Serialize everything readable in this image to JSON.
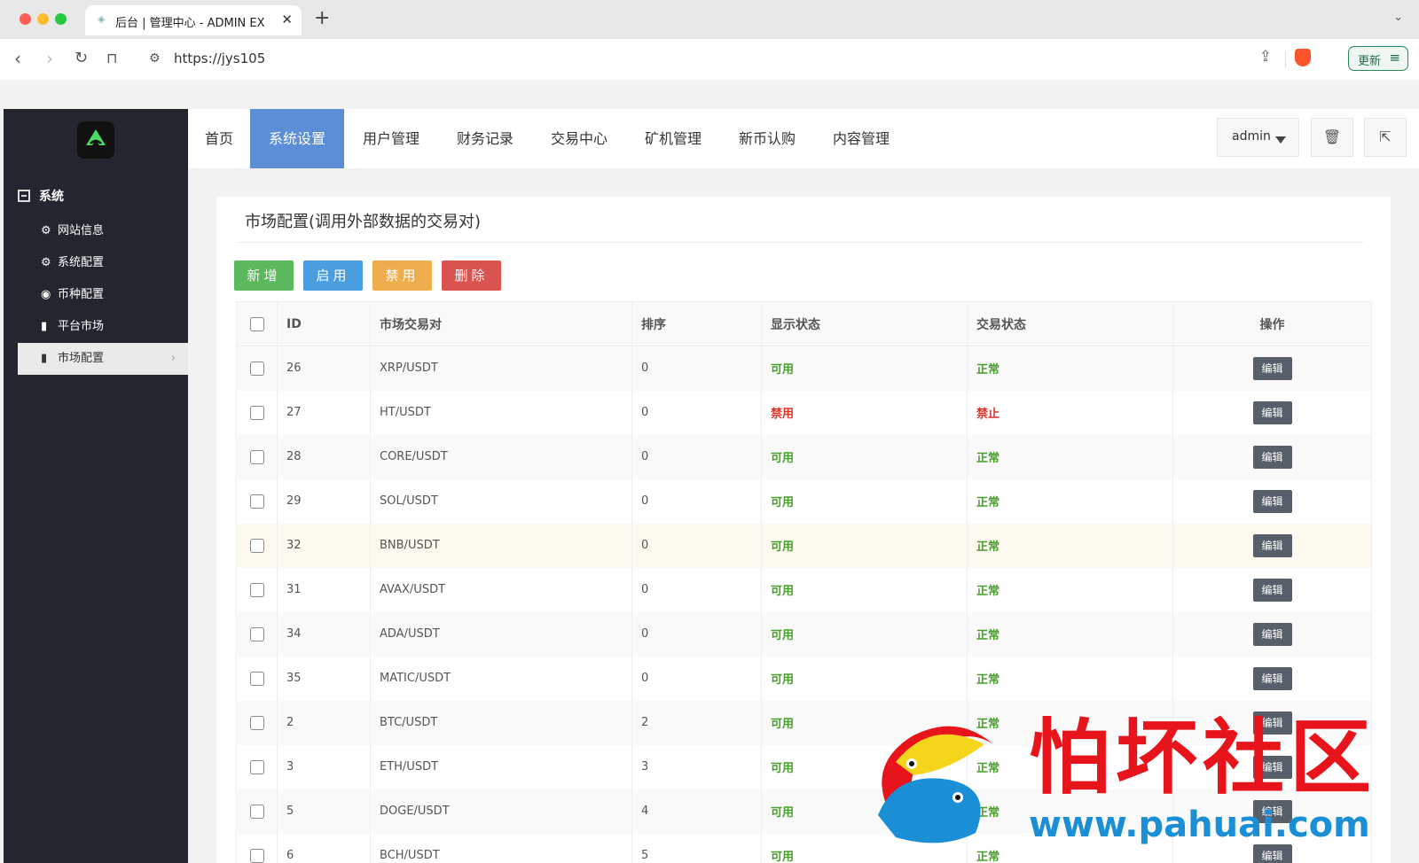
{
  "browser": {
    "tab_title": "后台 | 管理中心 - ADMIN EX",
    "url": "https://jys105",
    "update_label": "更新"
  },
  "sidebar": {
    "group": "系统",
    "items": [
      {
        "label": "网站信息",
        "icon": "gear-icon"
      },
      {
        "label": "系统配置",
        "icon": "gear-icon"
      },
      {
        "label": "币种配置",
        "icon": "target-icon"
      },
      {
        "label": "平台市场",
        "icon": "bar-chart-icon"
      },
      {
        "label": "市场配置",
        "icon": "bar-chart-icon",
        "active": true
      }
    ]
  },
  "topnav": {
    "items": [
      "首页",
      "系统设置",
      "用户管理",
      "财务记录",
      "交易中心",
      "矿机管理",
      "新币认购",
      "内容管理"
    ],
    "active": "系统设置",
    "user": "admin"
  },
  "panel": {
    "title": "市场配置(调用外部数据的交易对)",
    "buttons": {
      "add": "新增",
      "enable": "启用",
      "disable": "禁用",
      "delete": "删除"
    },
    "columns": [
      "ID",
      "市场交易对",
      "排序",
      "显示状态",
      "交易状态",
      "操作"
    ],
    "edit_label": "编辑",
    "rows": [
      {
        "id": "26",
        "pair": "XRP/USDT",
        "sort": "0",
        "display": "可用",
        "trade": "正常"
      },
      {
        "id": "27",
        "pair": "HT/USDT",
        "sort": "0",
        "display": "禁用",
        "trade": "禁止"
      },
      {
        "id": "28",
        "pair": "CORE/USDT",
        "sort": "0",
        "display": "可用",
        "trade": "正常"
      },
      {
        "id": "29",
        "pair": "SOL/USDT",
        "sort": "0",
        "display": "可用",
        "trade": "正常"
      },
      {
        "id": "32",
        "pair": "BNB/USDT",
        "sort": "0",
        "display": "可用",
        "trade": "正常"
      },
      {
        "id": "31",
        "pair": "AVAX/USDT",
        "sort": "0",
        "display": "可用",
        "trade": "正常"
      },
      {
        "id": "34",
        "pair": "ADA/USDT",
        "sort": "0",
        "display": "可用",
        "trade": "正常"
      },
      {
        "id": "35",
        "pair": "MATIC/USDT",
        "sort": "0",
        "display": "可用",
        "trade": "正常"
      },
      {
        "id": "2",
        "pair": "BTC/USDT",
        "sort": "2",
        "display": "可用",
        "trade": "正常"
      },
      {
        "id": "3",
        "pair": "ETH/USDT",
        "sort": "3",
        "display": "可用",
        "trade": "正常"
      },
      {
        "id": "5",
        "pair": "DOGE/USDT",
        "sort": "4",
        "display": "可用",
        "trade": "正常"
      },
      {
        "id": "6",
        "pair": "BCH/USDT",
        "sort": "5",
        "display": "可用",
        "trade": "正常"
      }
    ]
  },
  "watermark": {
    "chinese": "怕坏社区",
    "url": "www.pahuai.com"
  },
  "colors": {
    "sidebar_bg": "#23262e",
    "nav_active": "#5b8ed6",
    "ok_green": "#4a9e2f",
    "bad_red": "#d9352b"
  }
}
